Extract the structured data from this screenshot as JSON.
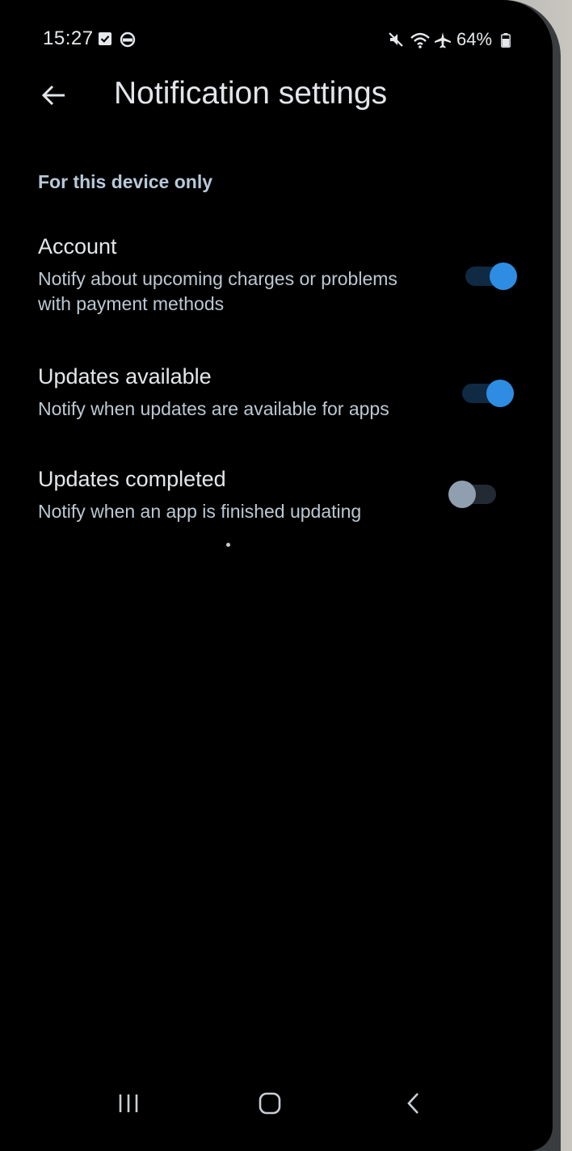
{
  "status_bar": {
    "time": "15:27",
    "battery": "64%",
    "left_icons": [
      "checkbox-notification-icon",
      "circle-notification-icon"
    ],
    "right_icons": [
      "mute-icon",
      "wifi-icon",
      "airplane-icon",
      "battery-icon"
    ]
  },
  "header": {
    "back_icon": "arrow-back-icon",
    "title": "Notification settings"
  },
  "section": {
    "label": "For this device only"
  },
  "settings": [
    {
      "title": "Account",
      "description": "Notify about upcoming charges or problems with payment methods",
      "enabled": true
    },
    {
      "title": "Updates available",
      "description": "Notify when updates are available for apps",
      "enabled": true
    },
    {
      "title": "Updates completed",
      "description": "Notify when an app is finished updating",
      "enabled": false
    }
  ],
  "navigation_bar": {
    "recents_icon": "recents-icon",
    "home_icon": "home-icon",
    "back_icon": "nav-back-icon"
  },
  "colors": {
    "accent": "#2e8de2",
    "background": "#000000",
    "text_primary": "#e4e7ea",
    "text_secondary": "#bcc8d3"
  }
}
